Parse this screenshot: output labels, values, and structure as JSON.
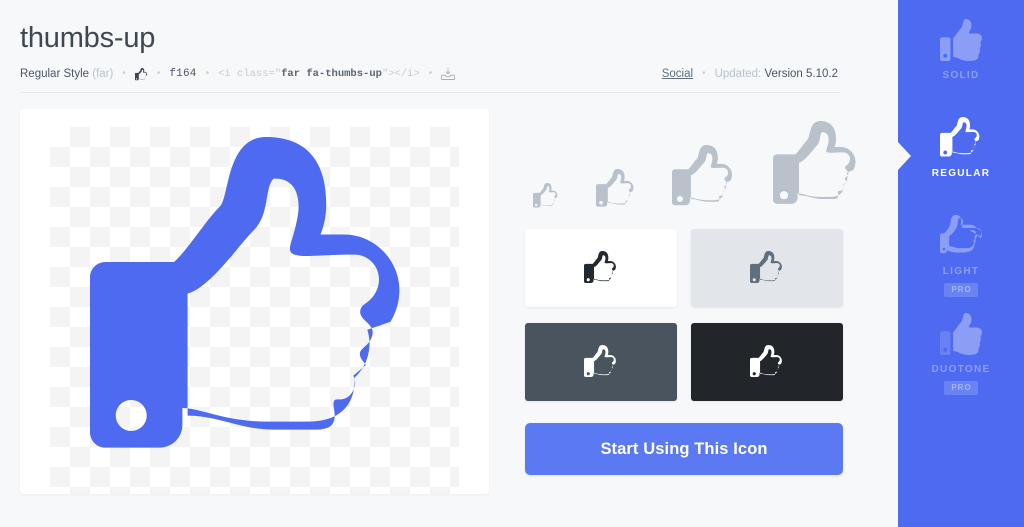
{
  "header": {
    "title": "thumbs-up",
    "style_label": "Regular Style",
    "style_code": "(far)",
    "glyph_icon": "thumbs-up-icon",
    "unicode": "f164",
    "snippet_prefix": "<i class=\"",
    "snippet_classes": "far fa-thumbs-up",
    "snippet_suffix": "\"></i>",
    "download_icon": "download-icon",
    "separator": "•",
    "category_link": "Social",
    "updated_label": "Updated:",
    "updated_version": "Version 5.10.2"
  },
  "preview": {
    "icon_name": "thumbs-up-icon",
    "icon_color": "#4e6af0",
    "background": "checkerboard-transparency"
  },
  "size_ramp": {
    "items": [
      {
        "name": "thumbs-up-icon-xs",
        "size": 26,
        "color": "#b9c1cb"
      },
      {
        "name": "thumbs-up-icon-sm",
        "size": 40,
        "color": "#b9c1cb"
      },
      {
        "name": "thumbs-up-icon-md",
        "size": 64,
        "color": "#b9c1cb"
      },
      {
        "name": "thumbs-up-icon-lg",
        "size": 88,
        "color": "#b9c1cb"
      }
    ]
  },
  "swatches": [
    {
      "name": "swatch-white",
      "bg": "#ffffff",
      "fg": "#22292f"
    },
    {
      "name": "swatch-light",
      "bg": "#e2e6ea",
      "fg": "#606f7b"
    },
    {
      "name": "swatch-slate",
      "bg": "#4a545e",
      "fg": "#ffffff"
    },
    {
      "name": "swatch-dark",
      "bg": "#22262b",
      "fg": "#ffffff"
    }
  ],
  "cta": {
    "label": "Start Using This Icon",
    "color": "#5a79f2"
  },
  "sidebar": {
    "background": "#4e6af0",
    "items": [
      {
        "name": "style-solid",
        "label": "SOLID",
        "active": false,
        "pro": null
      },
      {
        "name": "style-regular",
        "label": "REGULAR",
        "active": true,
        "pro": null
      },
      {
        "name": "style-light",
        "label": "LIGHT",
        "active": false,
        "pro": "PRO"
      },
      {
        "name": "style-duotone",
        "label": "DUOTONE",
        "active": false,
        "pro": "PRO"
      }
    ]
  }
}
